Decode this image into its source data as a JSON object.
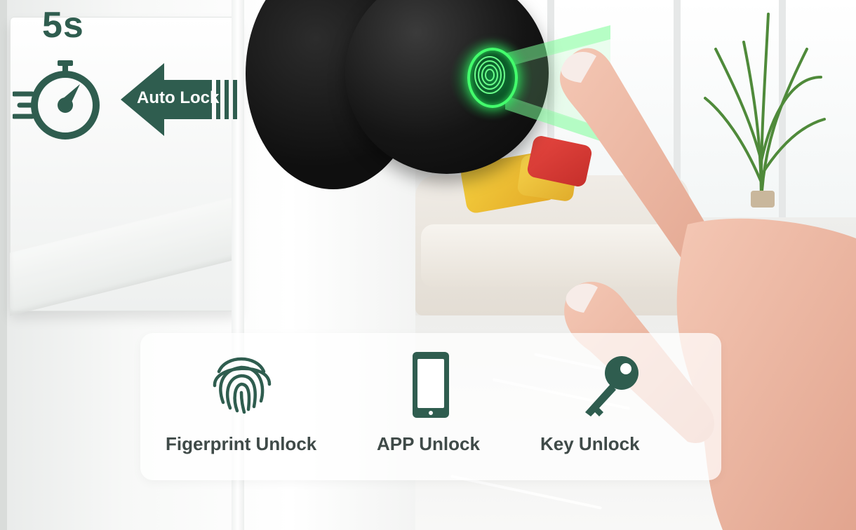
{
  "auto_lock": {
    "timer_value": "5s",
    "label": "Auto Lock",
    "timer_icon": "stopwatch-icon",
    "arrow_icon": "left-arrow-icon"
  },
  "unlock_methods": [
    {
      "label": "Figerprint Unlock",
      "icon": "fingerprint-icon"
    },
    {
      "label": "APP Unlock",
      "icon": "smartphone-icon"
    },
    {
      "label": "Key Unlock",
      "icon": "key-icon"
    }
  ],
  "colors": {
    "accent": "#2f5d4f",
    "label_text": "#3f4a48",
    "sensor_glow": "#44ff6d"
  }
}
